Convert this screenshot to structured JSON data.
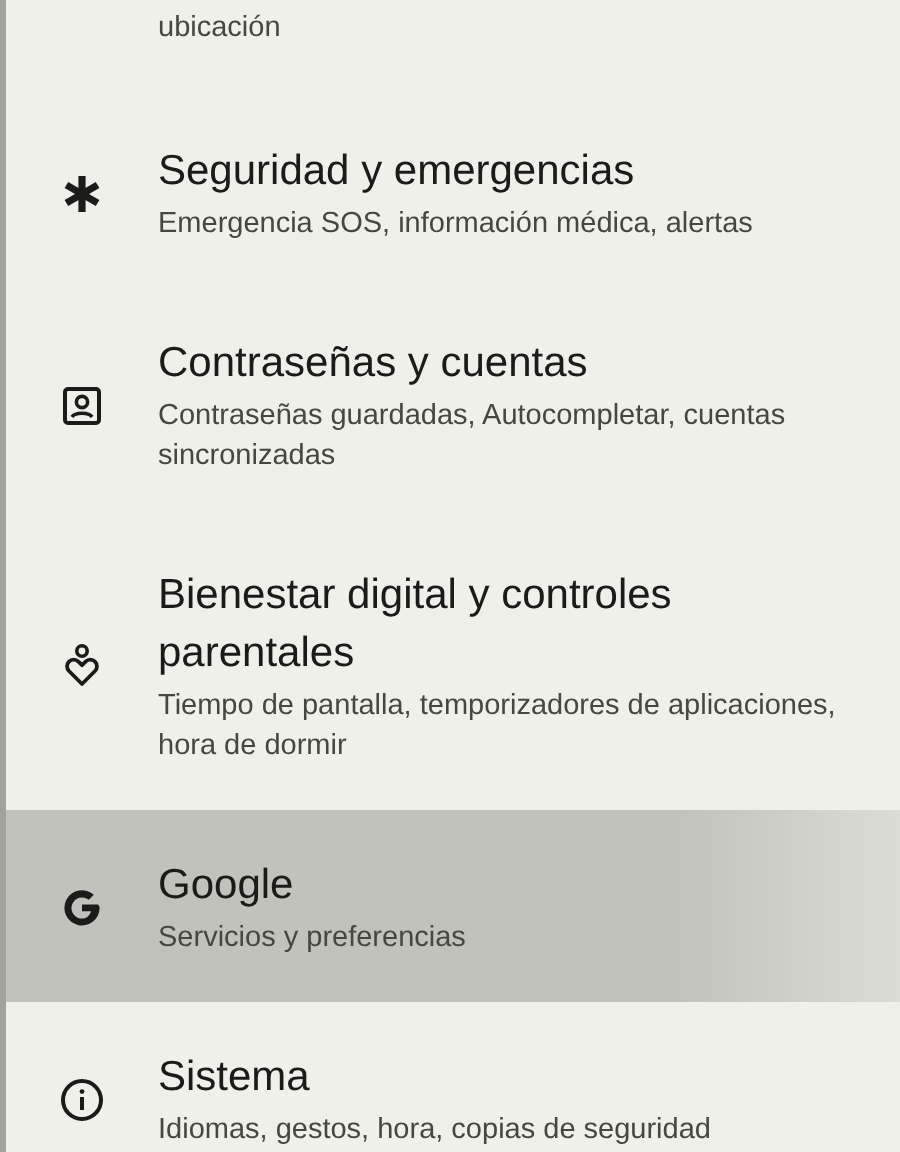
{
  "settings_list": {
    "items": [
      {
        "kind": "partial",
        "subtitle": "ubicación",
        "selected": false
      },
      {
        "kind": "asterisk",
        "title": "Seguridad y emergencias",
        "subtitle": "Emergencia SOS, información médica, alertas",
        "selected": false
      },
      {
        "kind": "account",
        "title": "Contraseñas y cuentas",
        "subtitle": "Contraseñas guardadas, Autocompletar, cuentas sincronizadas",
        "selected": false
      },
      {
        "kind": "wellbeing",
        "title": "Bienestar digital y controles parentales",
        "subtitle": "Tiempo de pantalla, temporizadores de aplicaciones, hora de dormir",
        "selected": false
      },
      {
        "kind": "google",
        "title": "Google",
        "subtitle": "Servicios y preferencias",
        "selected": true
      },
      {
        "kind": "info",
        "title": "Sistema",
        "subtitle": "Idiomas, gestos, hora, copias de seguridad",
        "selected": false
      }
    ]
  }
}
